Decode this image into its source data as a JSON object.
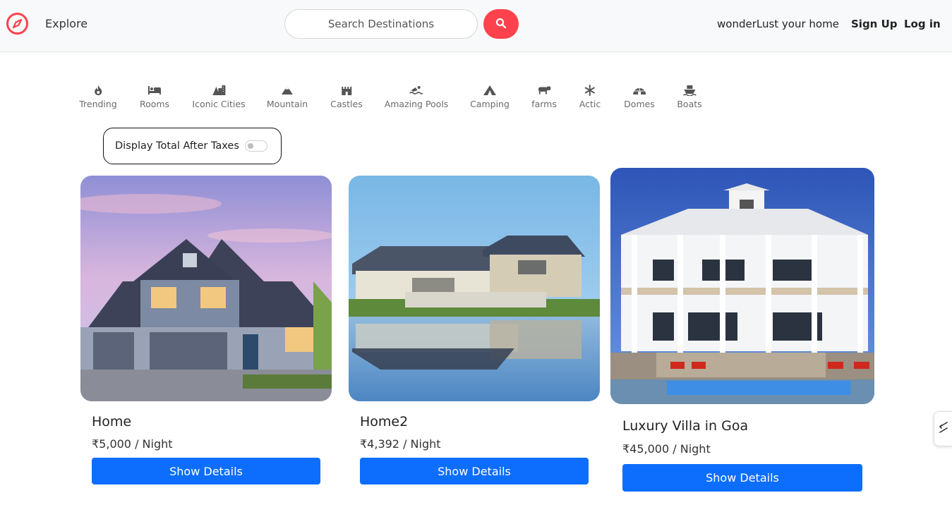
{
  "nav": {
    "brand_icon": "compass-icon",
    "explore": "Explore",
    "search_placeholder": "Search Destinations",
    "search_icon": "search-icon",
    "home_link": "wonderLust your home",
    "signup": "Sign Up",
    "login": "Log in"
  },
  "filters": [
    {
      "label": "Trending",
      "icon": "fire-icon"
    },
    {
      "label": "Rooms",
      "icon": "bed-icon"
    },
    {
      "label": "Iconic Cities",
      "icon": "city-icon"
    },
    {
      "label": "Mountain",
      "icon": "mountain-icon"
    },
    {
      "label": "Castles",
      "icon": "castle-icon"
    },
    {
      "label": "Amazing Pools",
      "icon": "swimmer-icon"
    },
    {
      "label": "Camping",
      "icon": "tent-icon"
    },
    {
      "label": "farms",
      "icon": "cow-icon"
    },
    {
      "label": "Actic",
      "icon": "snowflake-icon"
    },
    {
      "label": "Domes",
      "icon": "igloo-icon"
    },
    {
      "label": "Boats",
      "icon": "ship-icon"
    }
  ],
  "tax_toggle": {
    "label": "Display Total After Taxes",
    "enabled": false
  },
  "listings": [
    {
      "title": "Home",
      "price": "₹5,000 / Night",
      "button": "Show Details",
      "image": "suburban-house-photo"
    },
    {
      "title": "Home2",
      "price": "₹4,392 / Night",
      "button": "Show Details",
      "image": "lakeside-house-photo"
    },
    {
      "title": "Luxury Villa in Goa",
      "price": "₹45,000 / Night",
      "button": "Show Details",
      "image": "beach-villa-photo"
    }
  ],
  "colors": {
    "brand": "#fe424d",
    "button": "#0d6efd",
    "navbar_bg": "#f8f9fa"
  }
}
